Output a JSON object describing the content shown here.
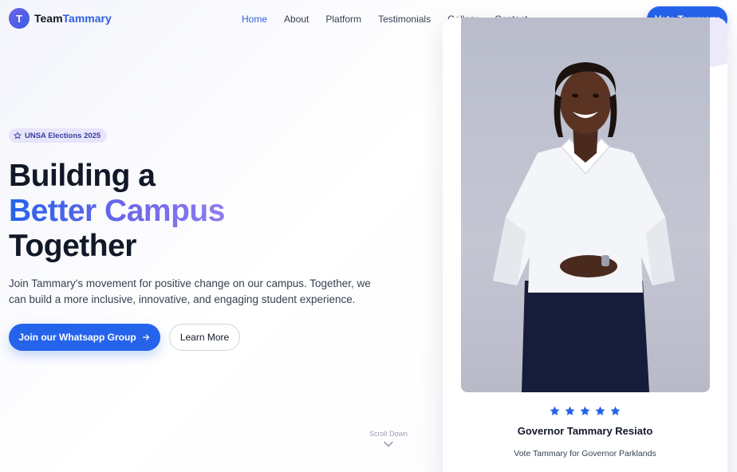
{
  "brand": {
    "initial": "T",
    "team": "Team",
    "name": "Tammary"
  },
  "nav": {
    "links": [
      "Home",
      "About",
      "Platform",
      "Testimonials",
      "Gallery",
      "Contact"
    ],
    "active": "Home",
    "cta": "Vote Tammary"
  },
  "hero": {
    "badge": "UNSA Elections 2025",
    "headline_line1": "Building a",
    "headline_line2": "Better Campus",
    "headline_line3": "Together",
    "lead": "Join Tammary's movement for positive change on our campus. Together, we can build a more inclusive, innovative, and engaging student experience.",
    "primary_button": "Join our Whatsapp Group",
    "secondary_button": "Learn More",
    "scroll_label": "Scroll Down"
  },
  "card": {
    "rating": 5,
    "name": "Governor Tammary Resiato",
    "subtitle": "Vote Tammary for Governor Parklands"
  },
  "colors": {
    "accent": "#2563eb",
    "gradient_end": "#8f7cf0",
    "badge_bg": "#e8e4fb"
  }
}
